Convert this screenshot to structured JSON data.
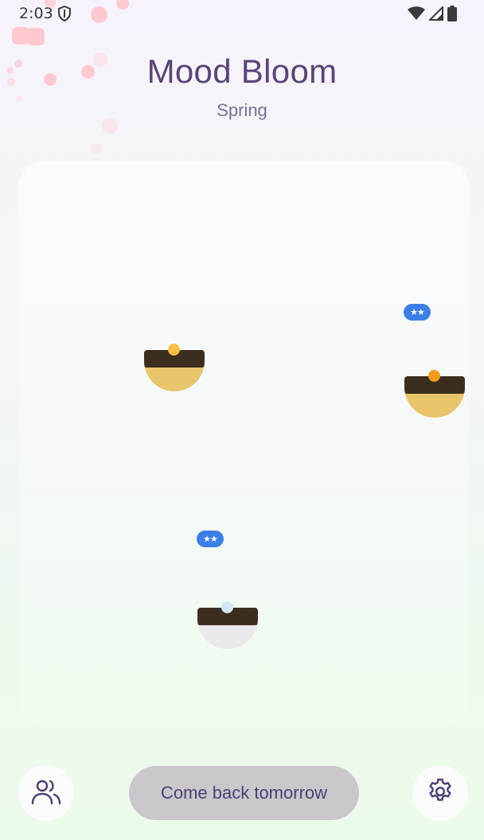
{
  "status_bar": {
    "time": "2:03",
    "icons": [
      "shield-icon",
      "wifi-icon",
      "signal-icon",
      "battery-icon"
    ]
  },
  "header": {
    "title": "Mood Bloom",
    "season": "Spring"
  },
  "garden": {
    "pots": [
      {
        "fill": "#e8c56a",
        "seed": "#f7c244"
      },
      {
        "fill": "#e8c56a",
        "seed": "#f39c1e"
      },
      {
        "fill": "#e9e9ec",
        "seed": "#cfe8f5"
      }
    ],
    "badges": [
      {
        "label": "★★"
      },
      {
        "label": "★★"
      }
    ]
  },
  "footer": {
    "friends_icon": "people-icon",
    "action_label": "Come back tomorrow",
    "settings_icon": "gear-icon"
  },
  "colors": {
    "title": "#5a4578",
    "badge": "#3c7fe6",
    "button": "#c9c7cc",
    "petal": "#ffc9cf"
  }
}
